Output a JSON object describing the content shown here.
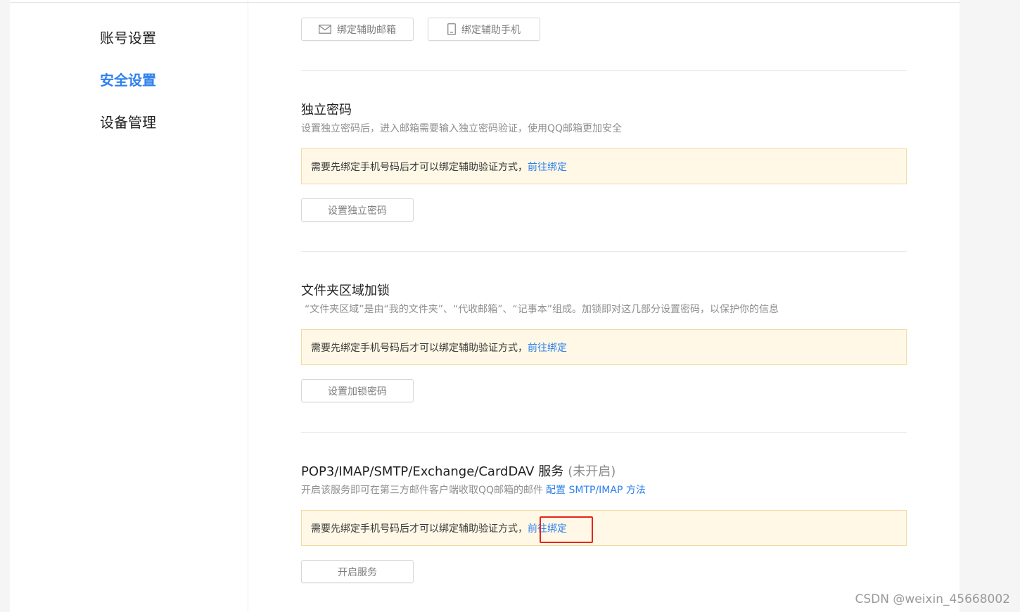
{
  "sidebar": {
    "items": [
      {
        "label": "账号设置",
        "active": false
      },
      {
        "label": "安全设置",
        "active": true
      },
      {
        "label": "设备管理",
        "active": false
      }
    ]
  },
  "top_buttons": {
    "bind_email": {
      "label": "绑定辅助邮箱",
      "icon": "mail-icon"
    },
    "bind_phone": {
      "label": "绑定辅助手机",
      "icon": "phone-icon"
    }
  },
  "sections": [
    {
      "title": "独立密码",
      "description": "设置独立密码后，进入邮箱需要输入独立密码验证，使用QQ邮箱更加安全",
      "notice": "需要先绑定手机号码后才可以绑定辅助验证方式，",
      "notice_link": "前往绑定",
      "button": "设置独立密码"
    },
    {
      "title": "文件夹区域加锁",
      "description": "“文件夹区域”是由“我的文件夹”、“代收邮箱”、“记事本”组成。加锁即对这几部分设置密码，以保护你的信息",
      "notice": "需要先绑定手机号码后才可以绑定辅助验证方式，",
      "notice_link": "前往绑定",
      "button": "设置加锁密码"
    },
    {
      "title": "POP3/IMAP/SMTP/Exchange/CardDAV 服务",
      "status": "(未开启)",
      "description": "开启该服务即可在第三方邮件客户端收取QQ邮箱的邮件",
      "description_link": "配置 SMTP/IMAP 方法",
      "notice": "需要先绑定手机号码后才可以绑定辅助验证方式，",
      "notice_link": "前往绑定",
      "button": "开启服务"
    }
  ],
  "colors": {
    "accent": "#2f80ed",
    "notice_bg": "#fff8e6",
    "notice_border": "#f3dba0",
    "highlight": "#e8231a"
  },
  "watermark": "CSDN @weixin_45668002"
}
